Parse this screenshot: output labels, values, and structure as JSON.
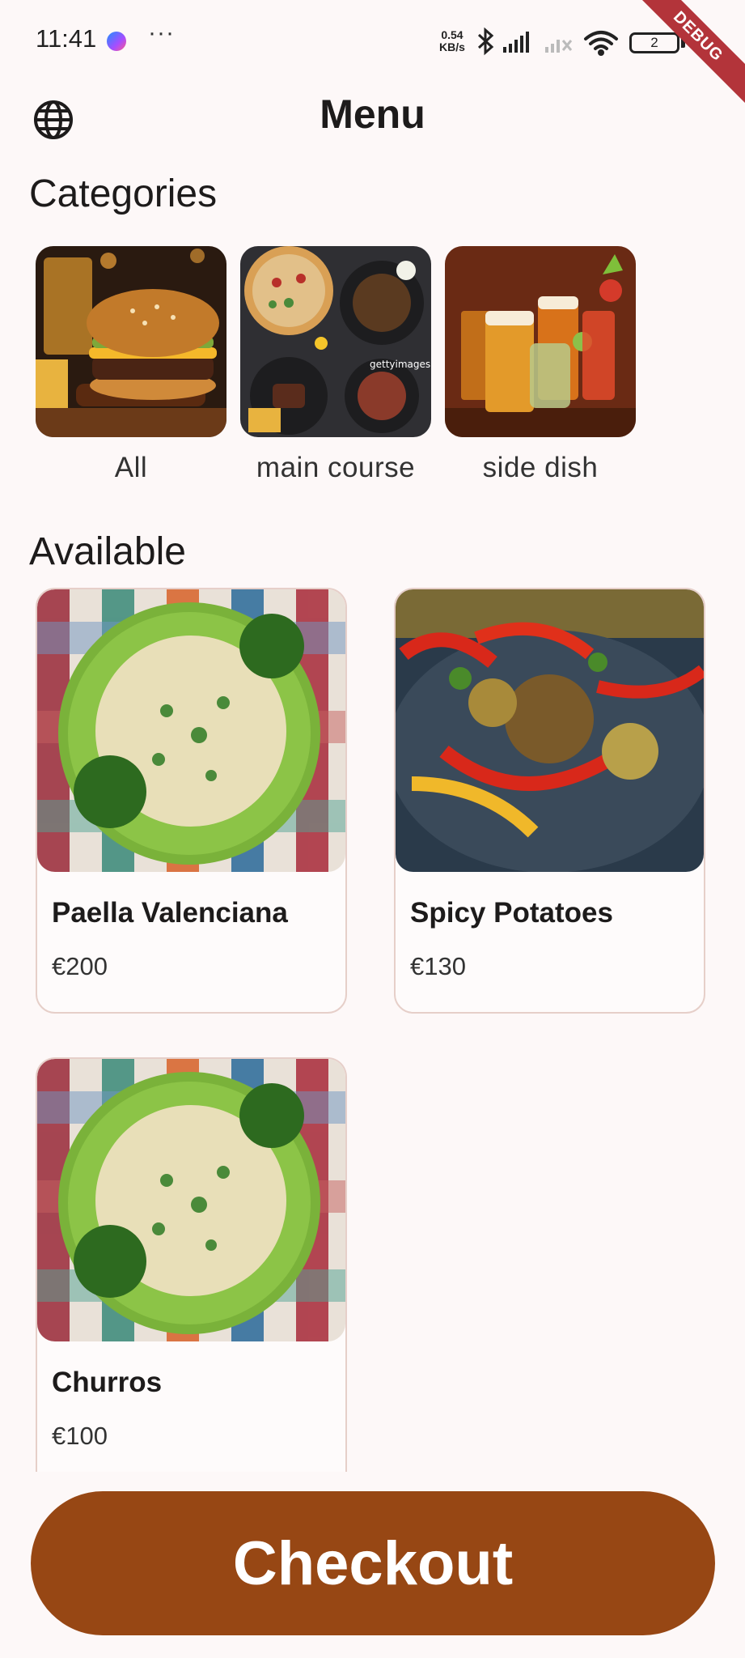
{
  "status_bar": {
    "time": "11:41",
    "more": "···",
    "net_speed_value": "0.54",
    "net_speed_unit": "KB/s",
    "battery": "2",
    "debug_ribbon": "DEBUG"
  },
  "app_bar": {
    "title": "Menu",
    "language_icon": "globe-icon"
  },
  "categories": {
    "title": "Categories",
    "items": [
      {
        "label": "All",
        "image": "burger-photo"
      },
      {
        "label": "main course",
        "image": "pizza-and-dishes-photo"
      },
      {
        "label": "side dish",
        "image": "drinks-photo"
      }
    ]
  },
  "available": {
    "title": "Available",
    "items": [
      {
        "name": "Paella Valenciana",
        "price": "€200",
        "image": "bowtie-pasta-photo"
      },
      {
        "name": "Spicy Potatoes",
        "price": "€130",
        "image": "peppers-chicken-photo"
      },
      {
        "name": "Churros",
        "price": "€100",
        "image": "bowtie-pasta-photo"
      }
    ]
  },
  "checkout": {
    "label": "Checkout"
  },
  "colors": {
    "accent": "#974714",
    "background": "#fdf8f8",
    "card_border": "#e6cfc9"
  }
}
